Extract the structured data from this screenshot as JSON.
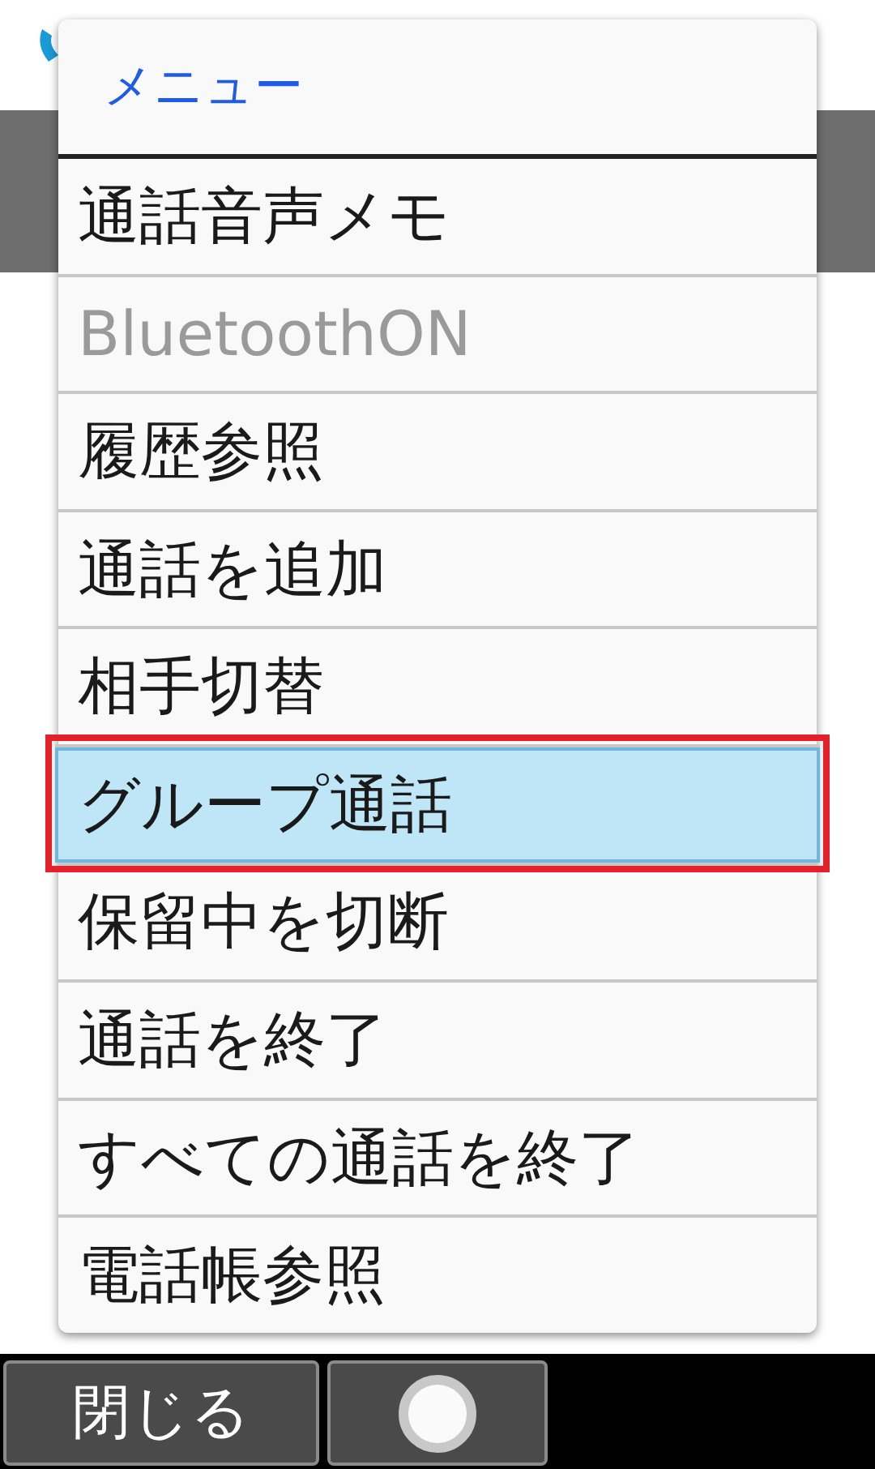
{
  "menu": {
    "title": "メニュー",
    "items": [
      {
        "label": "通話音声メモ",
        "disabled": false,
        "selected": false
      },
      {
        "label": "BluetoothON",
        "disabled": true,
        "selected": false
      },
      {
        "label": "履歴参照",
        "disabled": false,
        "selected": false
      },
      {
        "label": "通話を追加",
        "disabled": false,
        "selected": false
      },
      {
        "label": "相手切替",
        "disabled": false,
        "selected": false
      },
      {
        "label": "グループ通話",
        "disabled": false,
        "selected": true
      },
      {
        "label": "保留中を切断",
        "disabled": false,
        "selected": false
      },
      {
        "label": "通話を終了",
        "disabled": false,
        "selected": false
      },
      {
        "label": "すべての通話を終了",
        "disabled": false,
        "selected": false
      },
      {
        "label": "電話帳参照",
        "disabled": false,
        "selected": false
      }
    ]
  },
  "softkeys": [
    {
      "kind": "text",
      "label": "閉じる"
    },
    {
      "kind": "center"
    }
  ]
}
